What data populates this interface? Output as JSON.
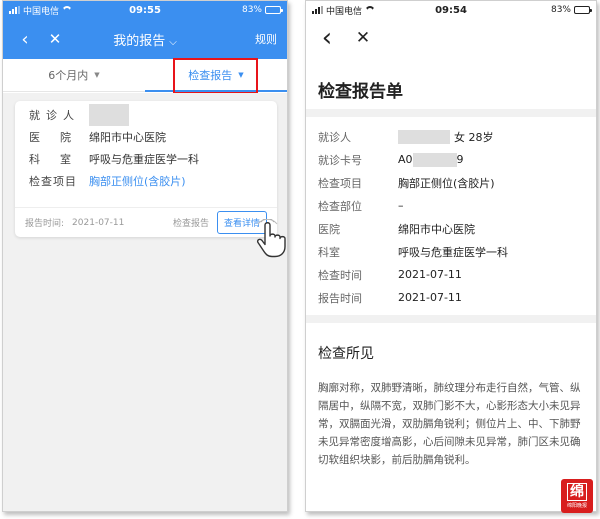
{
  "left": {
    "status": {
      "carrier": "中国电信",
      "time": "09:55",
      "battery": "83%",
      "battery_level": 0.83
    },
    "header": {
      "back_icon": "‹",
      "close_icon": "✕",
      "title": "我的报告",
      "title_chevron": "⌵",
      "rule": "规则"
    },
    "tabs": [
      {
        "label": "6个月内",
        "caret": "▼"
      },
      {
        "label": "检查报告",
        "caret": "▼"
      }
    ],
    "card": {
      "rows": [
        {
          "label": "就诊人",
          "value": ""
        },
        {
          "label": "医院",
          "value": "绵阳市中心医院"
        },
        {
          "label": "科室",
          "value": "呼吸与危重症医学一科"
        },
        {
          "label": "检查项目",
          "value": "胸部正侧位(含胶片)"
        }
      ],
      "footer": {
        "time_label": "报告时间:",
        "date": "2021-07-11",
        "kind": "检查报告",
        "detail_button": "查看详情"
      }
    }
  },
  "right": {
    "status": {
      "carrier": "中国电信",
      "time": "09:54",
      "battery": "83%",
      "battery_level": 0.83
    },
    "topbar": {
      "back_icon": "‹",
      "close_icon": "✕"
    },
    "title": "检查报告单",
    "info": [
      {
        "label": "就诊人",
        "value": "女  28岁"
      },
      {
        "label": "就诊卡号",
        "value": "A0",
        "value_tail": "9"
      },
      {
        "label": "检查项目",
        "value": "胸部正侧位(含胶片)"
      },
      {
        "label": "检查部位",
        "value": "–"
      },
      {
        "label": "医院",
        "value": "绵阳市中心医院"
      },
      {
        "label": "科室",
        "value": "呼吸与危重症医学一科"
      },
      {
        "label": "检查时间",
        "value": "2021-07-11"
      },
      {
        "label": "报告时间",
        "value": "2021-07-11"
      }
    ],
    "findings_title": "检查所见",
    "findings": "胸廓对称，双肺野清晰，肺纹理分布走行自然，气管、纵隔居中，纵隔不宽，双肺门影不大，心影形态大小未见异常，双膈面光滑，双肋膈角锐利；侧位片上、中、下肺野未见异常密度增高影，心后间隙未见异常，肺门区未见确切软组织块影，前后肋膈角锐利。"
  },
  "watermark": {
    "text": "绵阳晚报"
  },
  "colors": {
    "accent": "#3b8ff0",
    "highlight": "#e8141a"
  }
}
